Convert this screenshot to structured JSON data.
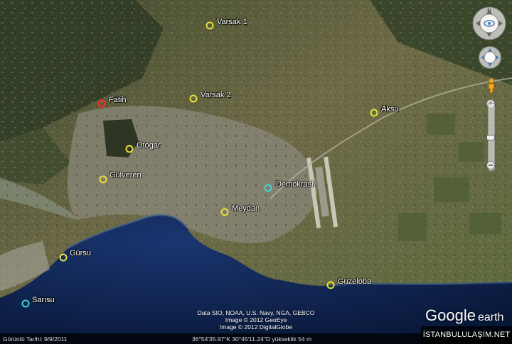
{
  "places": [
    {
      "name": "Varsak 1",
      "color": "#e8e23a"
    },
    {
      "name": "Varsak 2",
      "color": "#e8e23a"
    },
    {
      "name": "Fatih",
      "color": "#e2332a"
    },
    {
      "name": "Aksu",
      "color": "#e8e23a"
    },
    {
      "name": "Otogar",
      "color": "#e8e23a"
    },
    {
      "name": "Gülveren",
      "color": "#e8e23a"
    },
    {
      "name": "Demokrasi",
      "color": "#3ed6d8"
    },
    {
      "name": "Meydan",
      "color": "#e8e23a"
    },
    {
      "name": "Gürsu",
      "color": "#e8e23a"
    },
    {
      "name": "Guzeloba",
      "color": "#e8e23a"
    },
    {
      "name": "Sarısu",
      "color": "#3ed6d8"
    }
  ],
  "credits": {
    "line1": "Data SIO, NOAA, U.S. Navy, NGA, GEBCO",
    "line2": "Image © 2012 GeoEye",
    "line3": "Image © 2012 DigitalGlobe"
  },
  "status": {
    "imagery_date": "Görüntü Tarihi: 9/9/2011",
    "coordinates": "36°54'35.97\"K   30°45'11.24\"D  yükseklik    54 m"
  },
  "logo": {
    "google": "Google",
    "earth": "earth"
  },
  "watermark": "İSTANBULULAŞIM.NET",
  "colors": {
    "sea": "#0b1e4a",
    "land": "#6f6a45",
    "urban": "#8a877a"
  },
  "icons": {
    "navigation": "look-ring-icon",
    "move": "move-ring-icon",
    "street_view": "pegman-icon",
    "zoom_in": "zoom-in-icon",
    "zoom_out": "zoom-out-icon"
  }
}
